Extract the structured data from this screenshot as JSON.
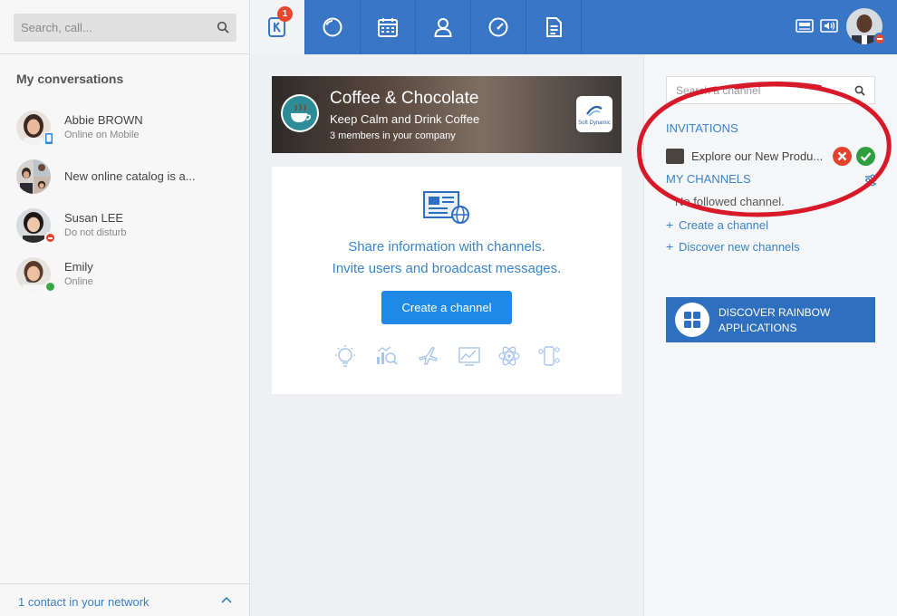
{
  "sidebar": {
    "search_placeholder": "Search, call...",
    "section_title": "My conversations",
    "conversations": [
      {
        "name": "Abbie BROWN",
        "status": "Online on Mobile"
      },
      {
        "name": "New online catalog is a..."
      },
      {
        "name": "Susan LEE",
        "status": "Do not disturb"
      },
      {
        "name": "Emily",
        "status": "Online"
      }
    ],
    "footer": "1 contact in your network"
  },
  "topbar": {
    "notification_count": "1",
    "tabs": [
      "channels-icon",
      "clock-icon",
      "calendar-icon",
      "contact-icon",
      "dashboard-icon",
      "document-icon"
    ]
  },
  "banner": {
    "title": "Coffee & Chocolate",
    "subtitle": "Keep Calm and Drink Coffee",
    "members": "3 members in your company",
    "company_label": "Soft Dynamic"
  },
  "card": {
    "line1": "Share information with channels.",
    "line2": "Invite users and broadcast messages.",
    "button": "Create a channel"
  },
  "right": {
    "search_placeholder": "Search a channel",
    "invitations_label": "INVITATIONS",
    "invitation_text": "Explore our New Produ...",
    "my_channels_label": "MY CHANNELS",
    "no_channel": "No followed channel.",
    "create_link": "Create a channel",
    "discover_link": "Discover new channels",
    "discover_button_line1": "DISCOVER RAINBOW",
    "discover_button_line2": "APPLICATIONS"
  },
  "colors": {
    "topbar": "#3976c6",
    "accent": "#1f8ae5",
    "link": "#3a84c9",
    "annotation": "#d8192a"
  }
}
